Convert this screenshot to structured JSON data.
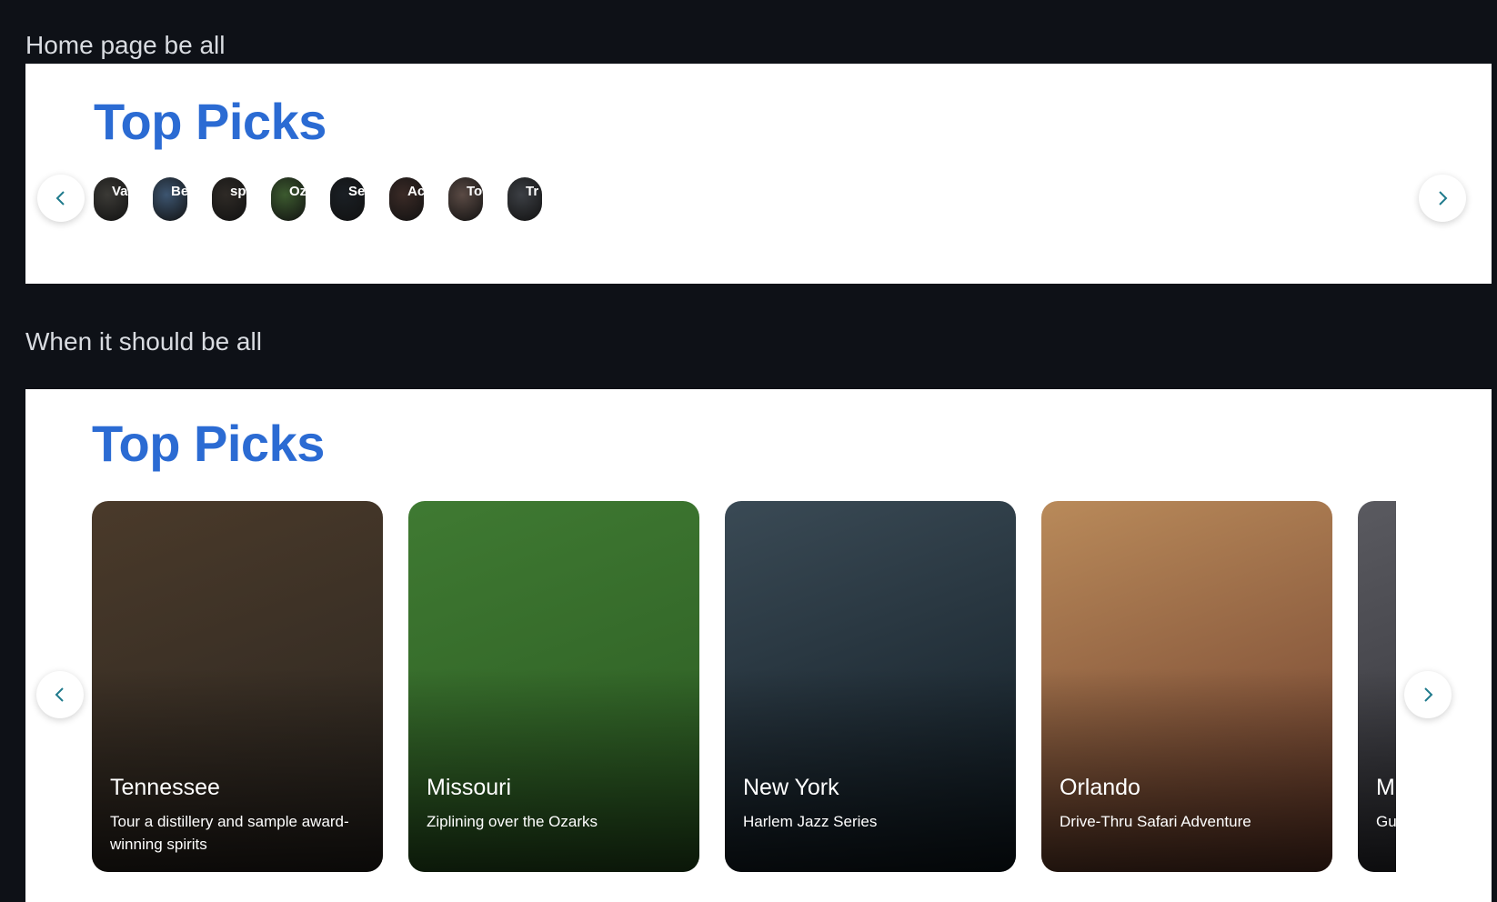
{
  "captions": {
    "top": "Home page be all",
    "bottom": "When it should be all"
  },
  "broken_section": {
    "title": "Top Picks",
    "mini_cards": [
      {
        "label": "Va",
        "color": "#3b3a36"
      },
      {
        "label": "Be",
        "color": "#3d5570"
      },
      {
        "label": "sp",
        "color": "#2e2a26"
      },
      {
        "label": "Oz",
        "color": "#3c5a2f"
      },
      {
        "label": "Se",
        "color": "#1a1f24"
      },
      {
        "label": "Ac",
        "color": "#3a2a26"
      },
      {
        "label": "To",
        "color": "#5a4a44"
      },
      {
        "label": "Tr",
        "color": "#3c3f44"
      }
    ]
  },
  "fixed_section": {
    "title": "Top Picks",
    "cards": [
      {
        "place": "Tennessee",
        "desc": "Tour a distillery and sample award-winning spirits",
        "color_a": "#4a3a2a",
        "color_b": "#2a2520"
      },
      {
        "place": "Missouri",
        "desc": "Ziplining over the Ozarks",
        "color_a": "#3f7a32",
        "color_b": "#2b5a22"
      },
      {
        "place": "New York",
        "desc": "Harlem Jazz Series",
        "color_a": "#3a4a55",
        "color_b": "#0f1a22"
      },
      {
        "place": "Orlando",
        "desc": "Drive-Thru Safari Adventure",
        "color_a": "#b98a5a",
        "color_b": "#6a3a2a"
      },
      {
        "place": "M",
        "desc": "Gu",
        "color_a": "#5a5a60",
        "color_b": "#2a2a30"
      }
    ]
  },
  "icons": {
    "prev": "chevron-left-icon",
    "next": "chevron-right-icon"
  },
  "colors": {
    "accent": "#2b6bd3",
    "chevron": "#1f7a8c",
    "background": "#0e1117"
  }
}
